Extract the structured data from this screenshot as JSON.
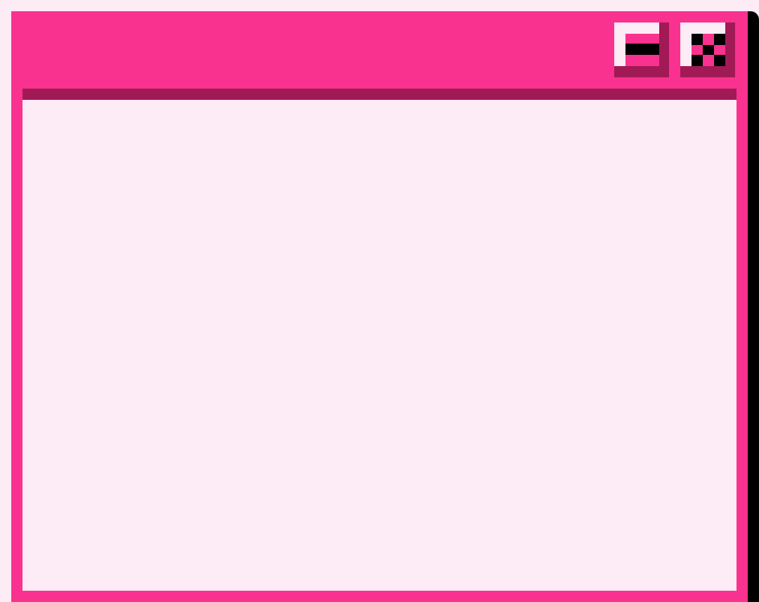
{
  "window": {
    "title": "",
    "controls": {
      "minimize_icon": "minimize-icon",
      "close_icon": "close-icon"
    }
  },
  "theme": {
    "frame": "#F9328F",
    "frame_dark": "#A11A55",
    "background": "#FDEBF5",
    "shadow": "#000000"
  }
}
